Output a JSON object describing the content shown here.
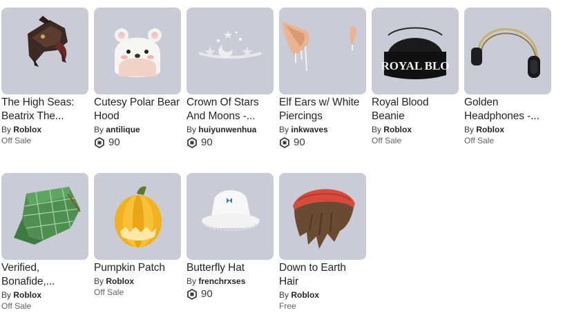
{
  "items": [
    {
      "name": "The High Seas: Beatrix The...",
      "by": "By",
      "creator": "Roblox",
      "status": "Off Sale",
      "price": null,
      "thumb_icon": "pirate-hat"
    },
    {
      "name": "Cutesy Polar Bear Hood",
      "by": "By",
      "creator": "antilique",
      "status": null,
      "price": "90",
      "thumb_icon": "polar-bear-hood"
    },
    {
      "name": "Crown Of Stars And Moons -...",
      "by": "By",
      "creator": "huiyunwenhua",
      "status": null,
      "price": "90",
      "thumb_icon": "star-crown"
    },
    {
      "name": "Elf Ears w/ White Piercings",
      "by": "By",
      "creator": "inkwaves",
      "status": null,
      "price": "90",
      "thumb_icon": "elf-ears"
    },
    {
      "name": "Royal Blood Beanie",
      "by": "By",
      "creator": "Roblox",
      "status": "Off Sale",
      "price": null,
      "thumb_icon": "black-beanie",
      "beanie_text": "ROYAL BLO"
    },
    {
      "name": "Golden Headphones -...",
      "by": "By",
      "creator": "Roblox",
      "status": "Off Sale",
      "price": null,
      "thumb_icon": "headphones"
    },
    {
      "name": "Verified, Bonafide,...",
      "by": "By",
      "creator": "Roblox",
      "status": "Off Sale",
      "price": null,
      "thumb_icon": "green-plaid-cap"
    },
    {
      "name": "Pumpkin Patch",
      "by": "By",
      "creator": "Roblox",
      "status": "Off Sale",
      "price": null,
      "thumb_icon": "pumpkin"
    },
    {
      "name": "Butterfly Hat",
      "by": "By",
      "creator": "frenchrxses",
      "status": null,
      "price": "90",
      "thumb_icon": "bucket-hat"
    },
    {
      "name": "Down to Earth Hair",
      "by": "By",
      "creator": "Roblox",
      "status": "Free",
      "price": null,
      "thumb_icon": "hair-beanie"
    }
  ],
  "colors": {
    "thumb_bg": "#c9ccd6",
    "text": "#232527",
    "muted": "#606264"
  }
}
